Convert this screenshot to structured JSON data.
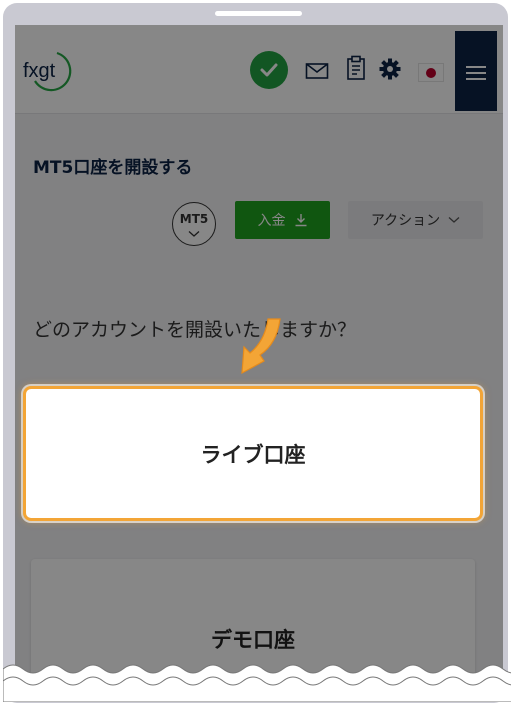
{
  "header": {
    "logo_text": "fxgt",
    "icons": [
      "check-icon",
      "mail-icon",
      "clipboard-icon",
      "gear-icon",
      "japan-flag-icon",
      "hamburger-menu-icon"
    ]
  },
  "main": {
    "title": "MT5口座を開設する",
    "platform_badge": "MT5",
    "deposit_label": "入金",
    "action_label": "アクション",
    "question": "どのアカウントを開設いたしますか？",
    "cards": [
      {
        "label": "ライブ口座"
      },
      {
        "label": "デモ口座"
      }
    ]
  },
  "colors": {
    "brand_navy": "#0c2245",
    "deposit_green": "#1fa21f",
    "check_green": "#23a243",
    "highlight_orange": "#f3a536"
  }
}
